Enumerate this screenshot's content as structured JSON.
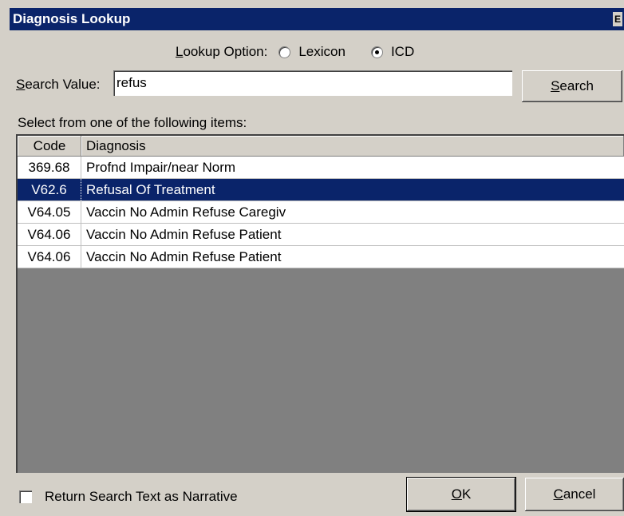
{
  "window": {
    "title": "Diagnosis Lookup",
    "title_edge": "E"
  },
  "lookup": {
    "label": "Lookup Option:",
    "options": [
      {
        "label": "Lexicon",
        "checked": false
      },
      {
        "label": "ICD",
        "checked": true
      }
    ]
  },
  "search": {
    "label": "Search Value:",
    "value": "refus",
    "button_label": "Search"
  },
  "list": {
    "instruction": "Select from one of the following items:",
    "columns": [
      "Code",
      "Diagnosis"
    ],
    "rows": [
      {
        "code": "369.68",
        "diagnosis": "Profnd Impair/near Norm",
        "selected": false
      },
      {
        "code": "V62.6",
        "diagnosis": "Refusal Of Treatment",
        "selected": true
      },
      {
        "code": "V64.05",
        "diagnosis": "Vaccin No Admin Refuse Caregiv",
        "selected": false
      },
      {
        "code": "V64.06",
        "diagnosis": "Vaccin No Admin Refuse Patient",
        "selected": false
      },
      {
        "code": "V64.06",
        "diagnosis": "Vaccin No Admin Refuse Patient",
        "selected": false
      }
    ]
  },
  "footer": {
    "checkbox_label": "Return Search Text as Narrative",
    "checkbox_checked": false,
    "ok_label": "OK",
    "cancel_label": "Cancel"
  },
  "colors": {
    "title_bar": "#0a246a",
    "selection": "#0a246a",
    "dialog": "#d4d0c8"
  }
}
